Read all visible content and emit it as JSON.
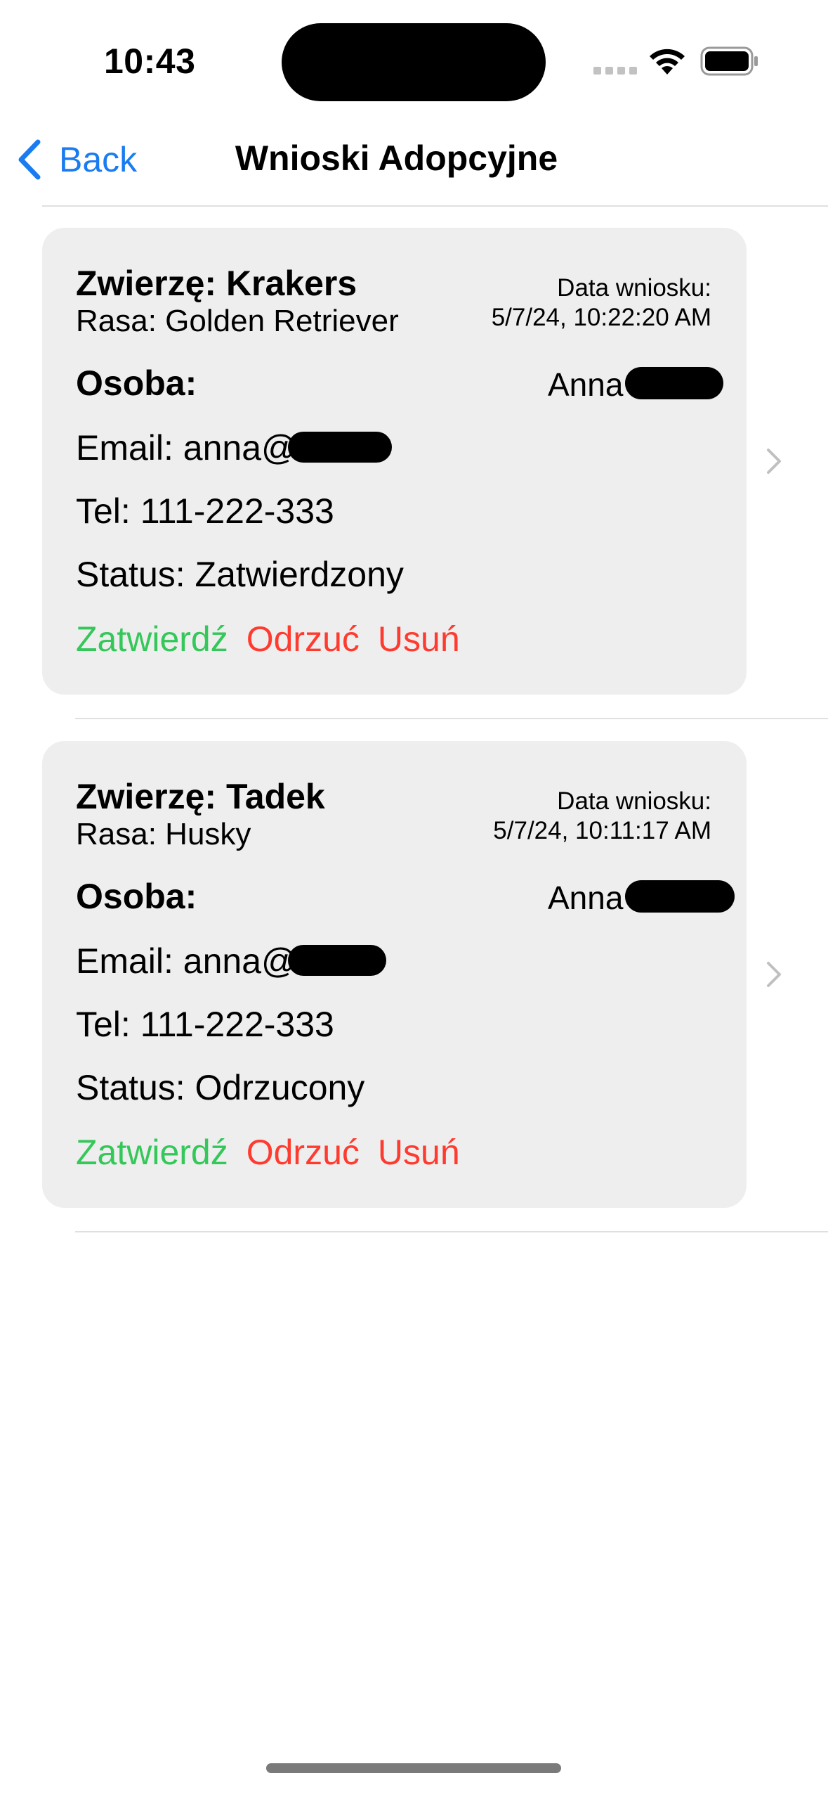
{
  "status_bar": {
    "time": "10:43",
    "signal_icon": "cellular-signal-icon",
    "wifi_icon": "wifi-icon",
    "battery_icon": "battery-icon"
  },
  "nav": {
    "back_label": "Back",
    "back_icon": "chevron-left-icon",
    "title": "Wnioski Adopcyjne"
  },
  "applications": [
    {
      "pet": "Zwierzę: Krakers",
      "breed": "Rasa: Golden Retriever",
      "date_label": "Data wniosku:",
      "date": "5/7/24, 10:22:20 AM",
      "person_label": "Osoba:",
      "person_name": "Anna",
      "email": "Email: anna@",
      "phone": "Tel: 111-222-333",
      "status": "Status: Zatwierdzony",
      "approve_label": "Zatwierdź",
      "reject_label": "Odrzuć",
      "delete_label": "Usuń"
    },
    {
      "pet": "Zwierzę: Tadek",
      "breed": "Rasa: Husky",
      "date_label": "Data wniosku:",
      "date": "5/7/24, 10:11:17 AM",
      "person_label": "Osoba:",
      "person_name": "Anna",
      "email": "Email: anna@",
      "phone": "Tel: 111-222-333",
      "status": "Status: Odrzucony",
      "approve_label": "Zatwierdź",
      "reject_label": "Odrzuć",
      "delete_label": "Usuń"
    }
  ],
  "colors": {
    "accent": "#1a7cf0",
    "approve": "#34c759",
    "reject": "#ff3b30",
    "card_bg": "#eeeeee"
  }
}
